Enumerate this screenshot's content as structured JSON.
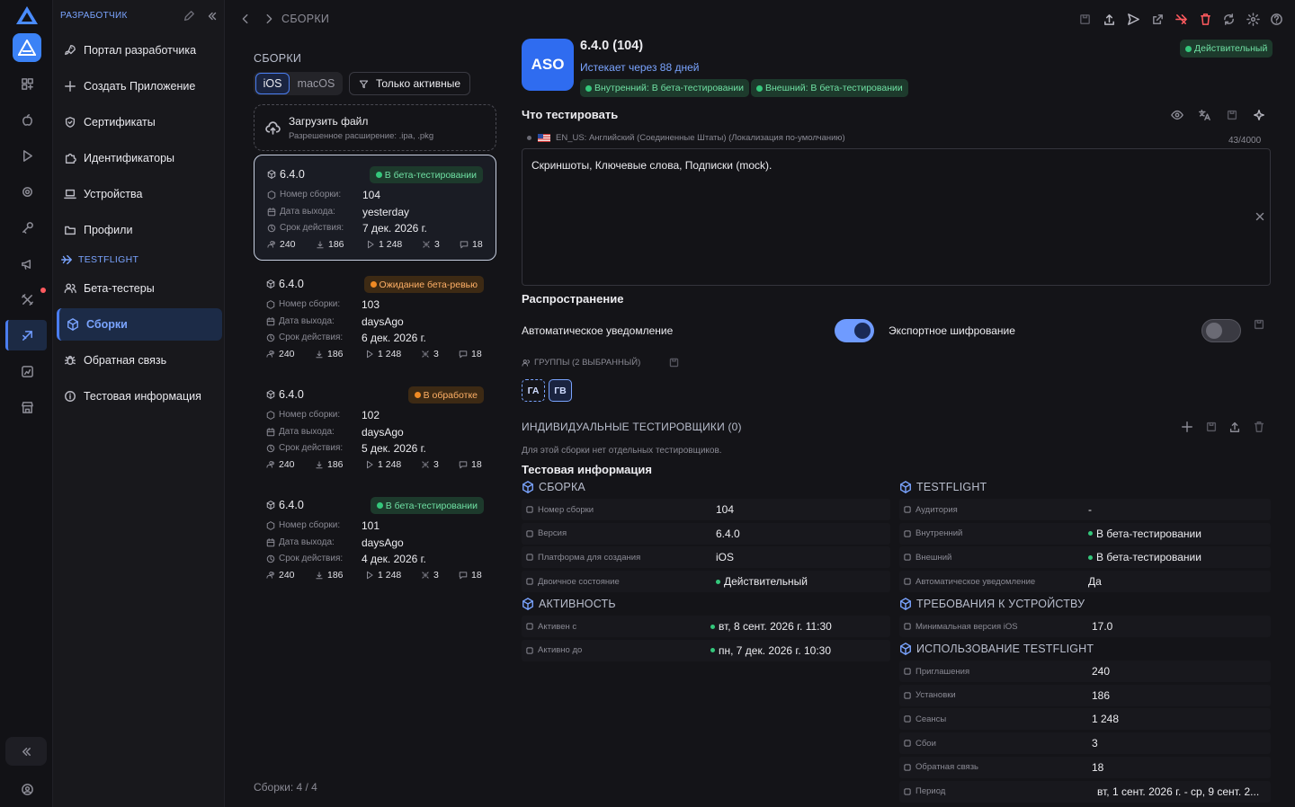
{
  "sidebar": {
    "section_developer": "РАЗРАБОТЧИК",
    "items_top": [
      {
        "label": "Портал разработчика",
        "icon": "rocket-icon"
      },
      {
        "label": "Создать Приложение",
        "icon": "plus-icon"
      },
      {
        "label": "Сертификаты",
        "icon": "shield-icon"
      },
      {
        "label": "Идентификаторы",
        "icon": "puzzle-icon"
      },
      {
        "label": "Устройства",
        "icon": "laptop-icon"
      },
      {
        "label": "Профили",
        "icon": "folder-icon"
      }
    ],
    "section_testflight": "TESTFLIGHT",
    "items_bottom": [
      {
        "label": "Бета-тестеры",
        "icon": "users-icon"
      },
      {
        "label": "Сборки",
        "icon": "builds-icon"
      },
      {
        "label": "Обратная связь",
        "icon": "bug-icon"
      },
      {
        "label": "Тестовая информация",
        "icon": "info-icon"
      }
    ]
  },
  "header": {
    "breadcrumb": "СБОРКИ"
  },
  "builds": {
    "title": "СБОРКИ",
    "platform_ios": "iOS",
    "platform_macos": "macOS",
    "filter_active": "Только активные",
    "upload_title": "Загрузить файл",
    "upload_hint": "Разрешенное расширение: .ipa, .pkg",
    "label_build_number": "Номер сборки:",
    "label_release_date": "Дата выхода:",
    "label_expiry": "Срок действия:",
    "items": [
      {
        "version": "6.4.0",
        "status": "В бета-тестировании",
        "status_color": "#34c77b",
        "build": "104",
        "release": "yesterday",
        "expiry": "7 дек. 2026 г.",
        "s1": "240",
        "s2": "186",
        "s3": "1 248",
        "s4": "3",
        "s5": "18"
      },
      {
        "version": "6.4.0",
        "status": "Ожидание бета-ревью",
        "status_color": "#f08a24",
        "build": "103",
        "release": "daysAgo",
        "expiry": "6 дек. 2026 г.",
        "s1": "240",
        "s2": "186",
        "s3": "1 248",
        "s4": "3",
        "s5": "18"
      },
      {
        "version": "6.4.0",
        "status": "В обработке",
        "status_color": "#f08a24",
        "build": "102",
        "release": "daysAgo",
        "expiry": "5 дек. 2026 г.",
        "s1": "240",
        "s2": "186",
        "s3": "1 248",
        "s4": "3",
        "s5": "18"
      },
      {
        "version": "6.4.0",
        "status": "В бета-тестировании",
        "status_color": "#34c77b",
        "build": "101",
        "release": "daysAgo",
        "expiry": "4 дек. 2026 г.",
        "s1": "240",
        "s2": "186",
        "s3": "1 248",
        "s4": "3",
        "s5": "18"
      }
    ],
    "footer": "Сборки: 4 / 4"
  },
  "detail": {
    "app_icon_text": "ASO",
    "title": "6.4.0 (104)",
    "expires": "Истекает через 88 дней",
    "pill_internal": "Внутренний: В бета-тестировании",
    "pill_external": "Внешний: В бета-тестировании",
    "status_badge": "Действительный",
    "what_to_test": "Что тестировать",
    "locale": "EN_US: Английский (Соединенные Штаты) (Локализация по-умолчанию)",
    "char_count": "43/4000",
    "notes": "Скриншоты, Ключевые слова, Подписки (mock).",
    "distribution": "Распространение",
    "auto_notify": "Автоматическое уведомление",
    "export_encryption": "Экспортное шифрование",
    "groups_label": "ГРУППЫ (2 ВЫБРАННЫЙ)",
    "group1": "ГА",
    "group2": "ГВ",
    "individual_testers": "ИНДИВИДУАЛЬНЫЕ ТЕСТИРОВЩИКИ (0)",
    "no_testers": "Для этой сборки нет отдельных тестировщиков.",
    "test_info": "Тестовая информация"
  },
  "info": {
    "build_section": "СБОРКА",
    "build_rows": [
      {
        "label": "Номер сборки",
        "value": "104"
      },
      {
        "label": "Версия",
        "value": "6.4.0"
      },
      {
        "label": "Платформа для создания",
        "value": "iOS"
      },
      {
        "label": "Двоичное состояние",
        "value": "Действительный"
      }
    ],
    "activity_section": "АКТИВНОСТЬ",
    "activity_rows": [
      {
        "label": "Активен с",
        "value": "вт, 8 сент. 2026 г. 11:30"
      },
      {
        "label": "Активно до",
        "value": "пн, 7 дек. 2026 г. 10:30"
      }
    ],
    "testflight_section": "TESTFLIGHT",
    "testflight_rows": [
      {
        "label": "Аудитория",
        "value": "-"
      },
      {
        "label": "Внутренний",
        "value": "В бета-тестировании"
      },
      {
        "label": "Внешний",
        "value": "В бета-тестировании"
      },
      {
        "label": "Автоматическое уведомление",
        "value": "Да"
      }
    ],
    "device_section": "ТРЕБОВАНИЯ К УСТРОЙСТВУ",
    "device_rows": [
      {
        "label": "Минимальная версия iOS",
        "value": "17.0"
      }
    ],
    "usage_section": "ИСПОЛЬЗОВАНИЕ TESTFLIGHT",
    "usage_rows": [
      {
        "label": "Приглашения",
        "value": "240"
      },
      {
        "label": "Установки",
        "value": "186"
      },
      {
        "label": "Сеансы",
        "value": "1 248"
      },
      {
        "label": "Сбои",
        "value": "3"
      },
      {
        "label": "Обратная связь",
        "value": "18"
      },
      {
        "label": "Период",
        "value": "вт, 1 сент. 2026 г. - ср, 9 сент. 2..."
      }
    ]
  },
  "colors": {
    "accent": "#4a7df0",
    "success": "#34c77b",
    "warning": "#f08a24",
    "danger": "#ff5a5f"
  }
}
